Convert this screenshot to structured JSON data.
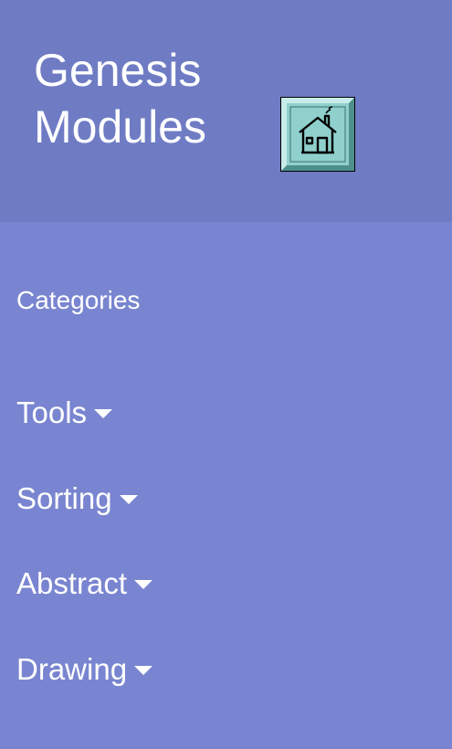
{
  "header": {
    "title_line1": "Genesis",
    "title_line2": "Modules",
    "home_button_icon": "house-icon"
  },
  "nav": {
    "heading": "Categories",
    "items": [
      {
        "label": "Tools"
      },
      {
        "label": "Sorting"
      },
      {
        "label": "Abstract"
      },
      {
        "label": "Drawing"
      }
    ]
  },
  "colors": {
    "header_bg": "#6f7cc4",
    "nav_bg": "#7985d0",
    "text": "#ffffff",
    "home_button_fill": "#8fd0cd"
  }
}
